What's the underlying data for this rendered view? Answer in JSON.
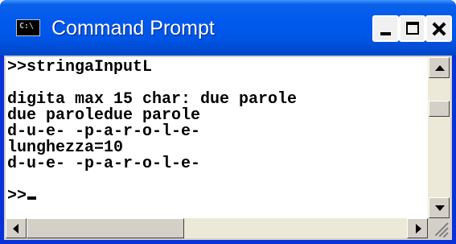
{
  "window": {
    "title": "Command Prompt",
    "icon_label": "C:\\",
    "controls": [
      "minimize-icon",
      "maximize-icon",
      "close-icon"
    ]
  },
  "console": {
    "lines": [
      ">>stringaInputL",
      "",
      "digita max 15 char: due parole",
      "due paroledue parole",
      "d-u-e- -p-a-r-o-l-e-",
      "lunghezza=10",
      "d-u-e- -p-a-r-o-l-e-",
      ">>"
    ]
  },
  "colors": {
    "titlebar": "#0058ee",
    "console_bg": "#ffffff",
    "console_text": "#000000",
    "scrollbar": "#d4d0c8"
  }
}
